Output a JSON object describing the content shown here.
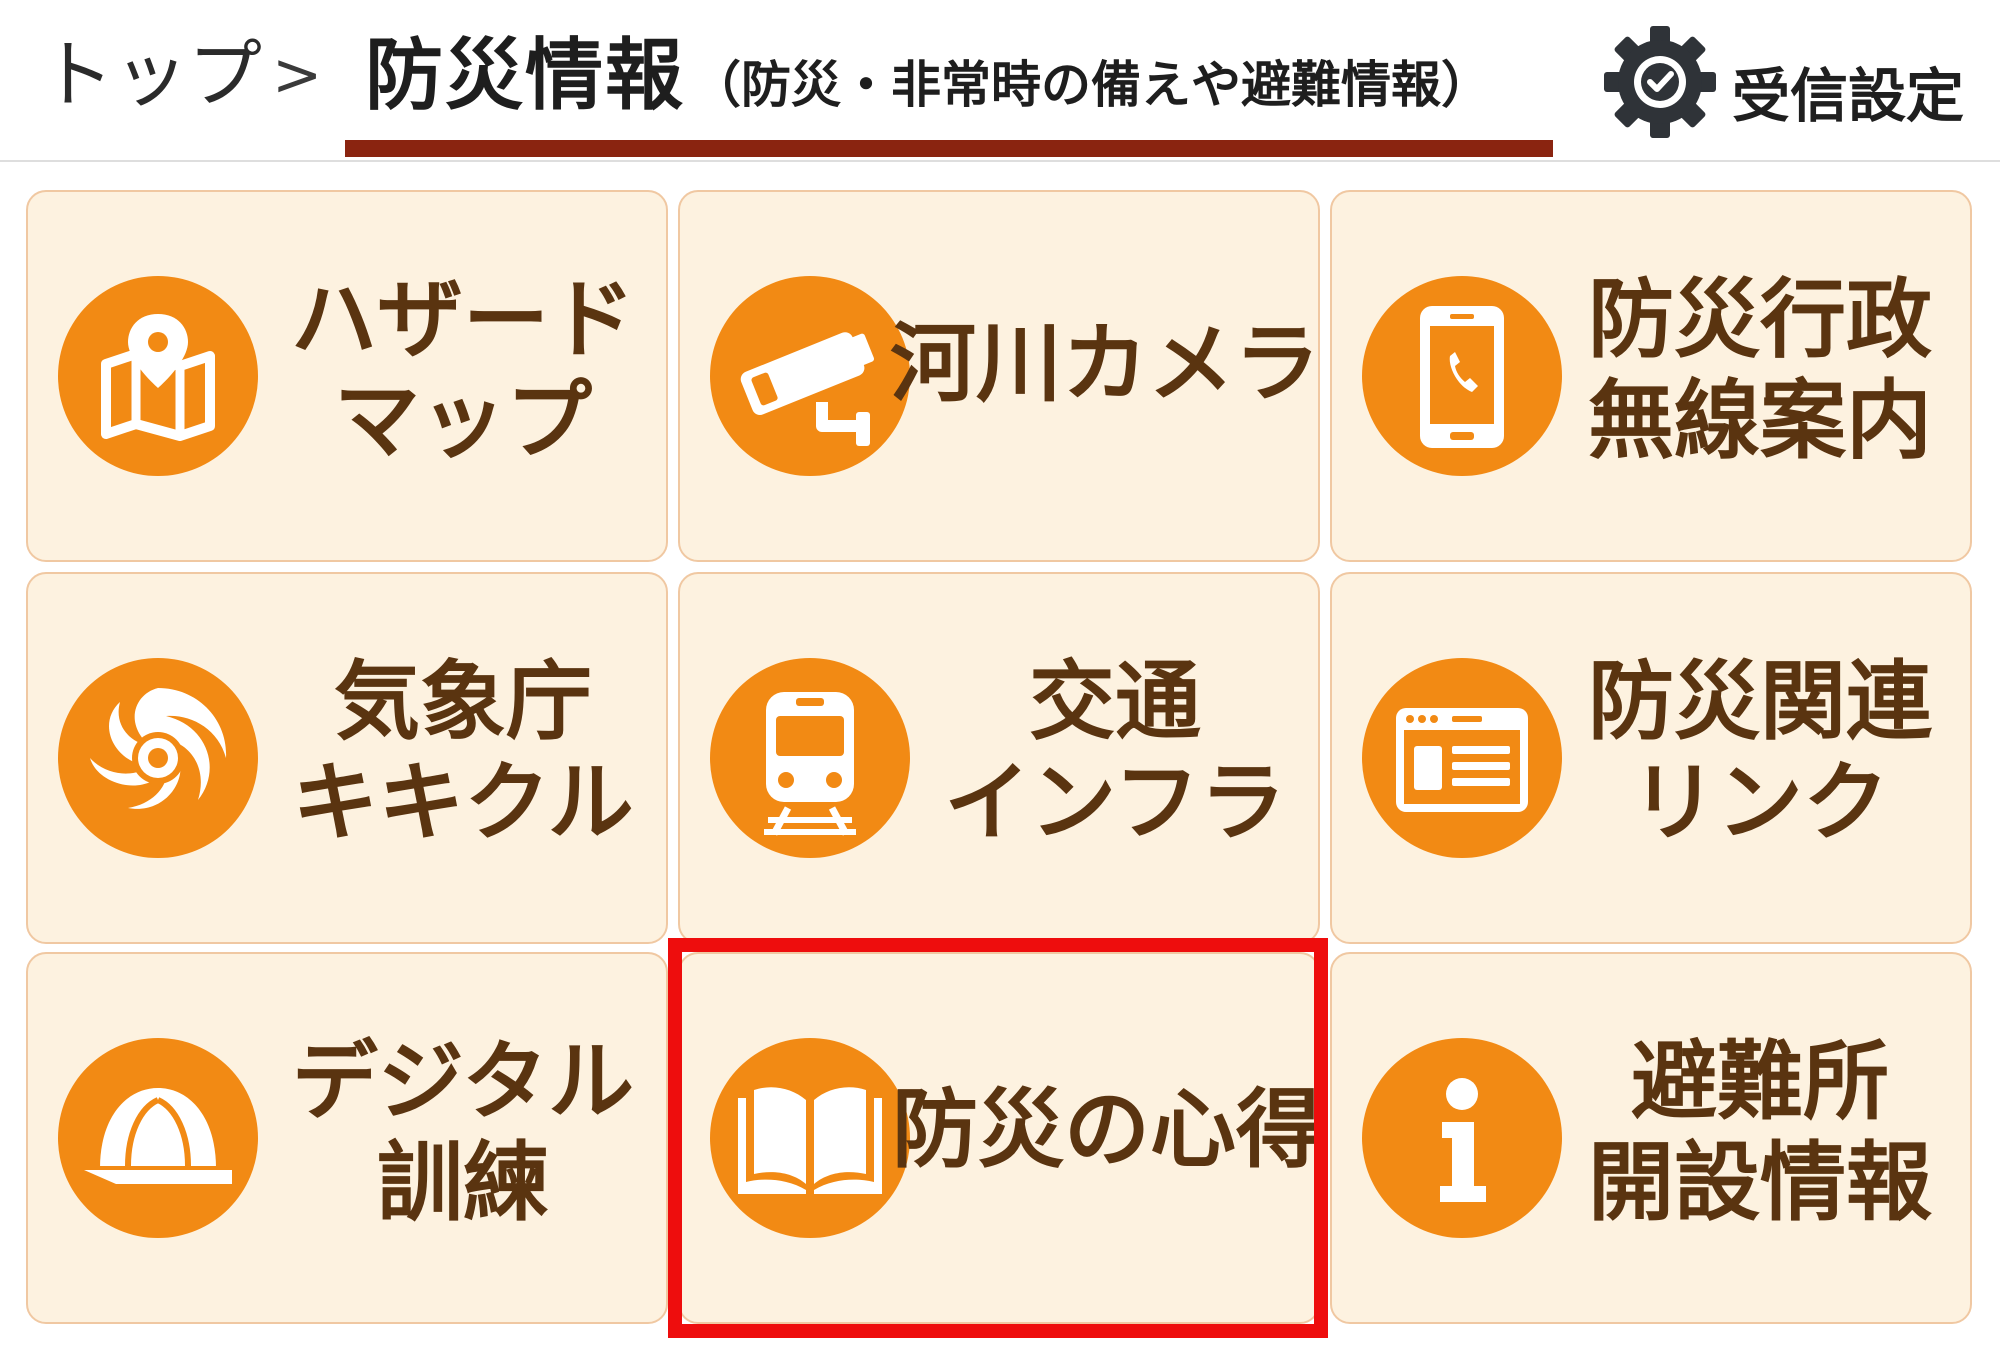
{
  "breadcrumb": {
    "top_label": "トップ",
    "separator": ">",
    "current_title": "防災情報",
    "current_subtitle": "（防災・非常時の備えや避難情報）"
  },
  "settings": {
    "label": "受信設定",
    "icon": "gear-check-icon"
  },
  "tiles": [
    {
      "lines": [
        "ハザード",
        "マップ"
      ],
      "icon": "map-pin-icon"
    },
    {
      "lines": [
        "河川カメラ"
      ],
      "icon": "security-camera-icon"
    },
    {
      "lines": [
        "防災行政",
        "無線案内"
      ],
      "icon": "smartphone-call-icon"
    },
    {
      "lines": [
        "気象庁",
        "キキクル"
      ],
      "icon": "typhoon-icon"
    },
    {
      "lines": [
        "交通",
        "インフラ"
      ],
      "icon": "train-icon"
    },
    {
      "lines": [
        "防災関連",
        "リンク"
      ],
      "icon": "browser-window-icon"
    },
    {
      "lines": [
        "デジタル",
        "訓練"
      ],
      "icon": "helmet-icon"
    },
    {
      "lines": [
        "防災の心得"
      ],
      "icon": "open-book-icon",
      "selected": true
    },
    {
      "lines": [
        "避難所",
        "開設情報"
      ],
      "icon": "info-icon"
    }
  ],
  "colors": {
    "accent": "#f28a14",
    "tile_background": "#fdf2e0",
    "tile_border": "#f0c8a2",
    "label_text": "#5a3410",
    "underline": "#8a2410",
    "selection": "#ee0d0d"
  }
}
